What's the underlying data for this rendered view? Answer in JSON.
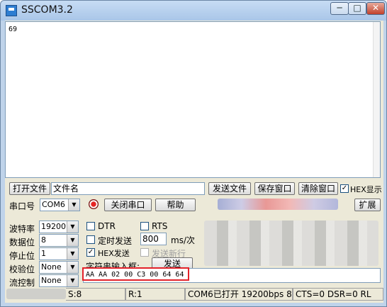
{
  "window": {
    "title": "SSCOM3.2",
    "min_label": "─",
    "max_label": "□",
    "close_label": "✕"
  },
  "receive": {
    "text": "69"
  },
  "row1": {
    "open_file": "打开文件",
    "filename": "文件名",
    "send_file": "发送文件",
    "save_window": "保存窗口",
    "clear_window": "清除窗口",
    "hex_display": "HEX显示",
    "hex_display_checked": "✓"
  },
  "row2": {
    "port_label": "串口号",
    "port_value": "COM6",
    "close_port": "关闭串口",
    "help": "帮助",
    "expand": "扩展"
  },
  "settings": {
    "baud_label": "波特率",
    "baud_value": "19200",
    "data_label": "数据位",
    "data_value": "8",
    "stop_label": "停止位",
    "stop_value": "1",
    "parity_label": "校验位",
    "parity_value": "None",
    "flow_label": "流控制",
    "flow_value": "None"
  },
  "options": {
    "dtr": "DTR",
    "rts": "RTS",
    "timed_send": "定时发送",
    "interval_value": "800",
    "interval_unit": "ms/次",
    "hex_send": "HEX发送",
    "hex_send_checked": "✓",
    "send_newline": "发送新行",
    "input_label": "字符串输入框:",
    "send_button": "发送",
    "input_value": "AA AA 02 00 C3 00 64 64"
  },
  "status": {
    "s": "S:8",
    "r": "R:1",
    "port_state": "COM6已打开  19200bps  8",
    "lines": "CTS=0 DSR=0 RL"
  },
  "colors": {
    "highlight": "#e3222a",
    "window_frame": "#bfd3ea",
    "client": "#ece9d8"
  }
}
